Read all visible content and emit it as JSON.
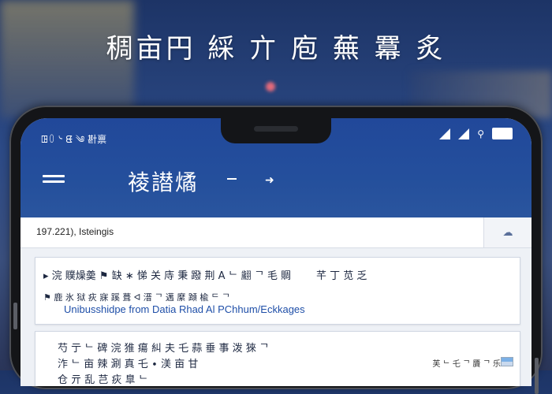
{
  "headline": "稠亩円 綵 亣 庖 蕪 羃 炙",
  "status_bar": {
    "left_text": "ꖸ꒩ ᔈ ᘀ ༄ 卙禀",
    "right_text": "⚲"
  },
  "app_bar": {
    "title": "祾譛燏"
  },
  "search": {
    "value": "197.221), Isteingis"
  },
  "card1": {
    "line1": "▸ 浣 贌燥羮 ⚑ 缺 ∗ 悌 关 庤 秉 蹳 荆 A ᄂ 翽 ᄀ 毛 賙",
    "right_text": "芊 丁 苋 乏",
    "line2": "⚑ 鹿 氷 狱 疢 寐 蹊 葺 ᐊ 溍 ᄀ 邁 縻 蹞 楡 ᄃ ᄀ",
    "link": "Unibusshidpe from Datia Rhad Al PChhum/Eckkages"
  },
  "card2": {
    "line1": "芍 亍 ᄂ 碑 浣 猚 瘍 糾 夫 乇 蒜 垂 事 泼 猍 ᄀ",
    "line2": "泎 ᄂ 亩 辣 涮 真 乇 ∙ 渼 亩 甘",
    "line3": "仓 亓 乱 芑 疢 臯 ᄂ",
    "meta": "芙 ᄂ 乇 ᄀ 贗 ᄀ 乐"
  },
  "colors": {
    "app_bar": "#21489a",
    "link": "#1f4fa8"
  }
}
